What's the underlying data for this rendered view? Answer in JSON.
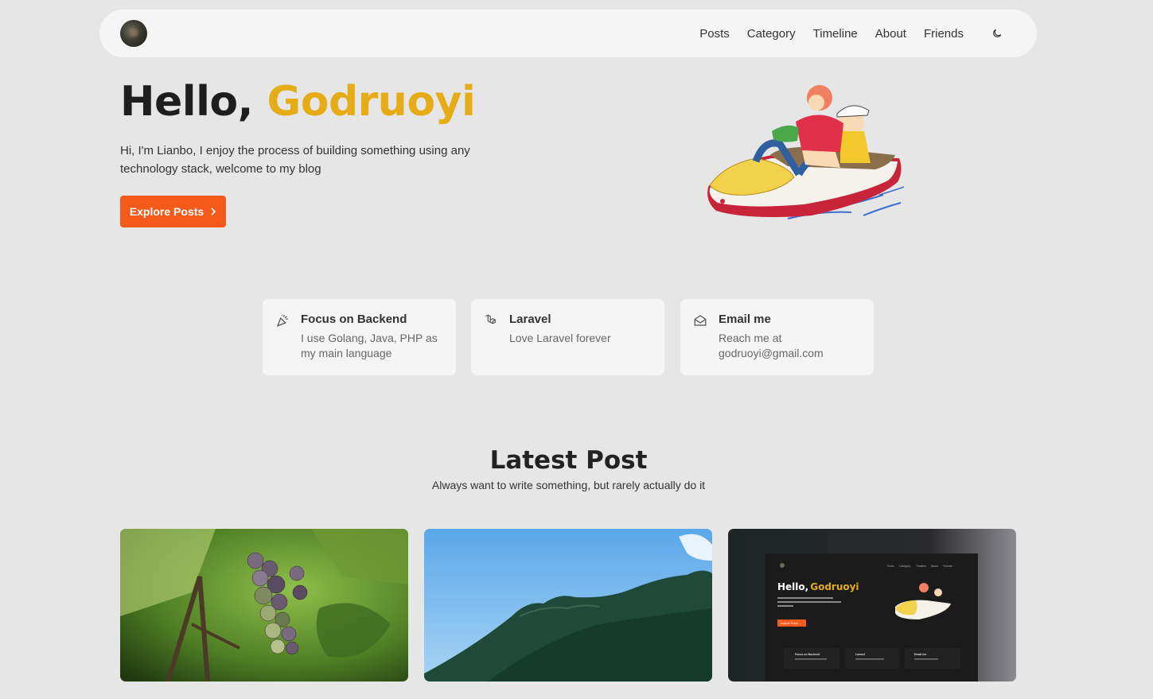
{
  "nav": {
    "links": [
      "Posts",
      "Category",
      "Timeline",
      "About",
      "Friends"
    ],
    "avatar_icon": "avatar-icon",
    "theme_icon": "moon-icon"
  },
  "hero": {
    "greeting": "Hello,",
    "name": "Godruoyi",
    "description": "Hi, I'm Lianbo, I enjoy the process of building something using any technology stack, welcome to my blog",
    "button_label": "Explore Posts",
    "button_icon": "chevron-right-icon"
  },
  "features": [
    {
      "icon": "party-popper-icon",
      "title": "Focus on Backend",
      "desc": "I use Golang, Java, PHP as my main language"
    },
    {
      "icon": "laravel-icon",
      "title": "Laravel",
      "desc": "Love Laravel forever"
    },
    {
      "icon": "mail-open-icon",
      "title": "Email me",
      "desc": "Reach me at godruoyi@gmail.com"
    }
  ],
  "latest": {
    "title": "Latest Post",
    "subtitle": "Always want to write something, but rarely actually do it"
  },
  "thumbnail_blog": {
    "nav_links": [
      "Posts",
      "Category",
      "Timeline",
      "About",
      "Friends"
    ],
    "greeting": "Hello,",
    "name": "Godruoyi",
    "button_label": "Explore Posts →",
    "features": [
      "Focus on Backend",
      "Laravel",
      "Email me"
    ]
  },
  "colors": {
    "accent_orange": "#f55a1a",
    "name_yellow": "#e5ac16",
    "background": "#e6e6e6",
    "card": "#f5f5f5"
  }
}
